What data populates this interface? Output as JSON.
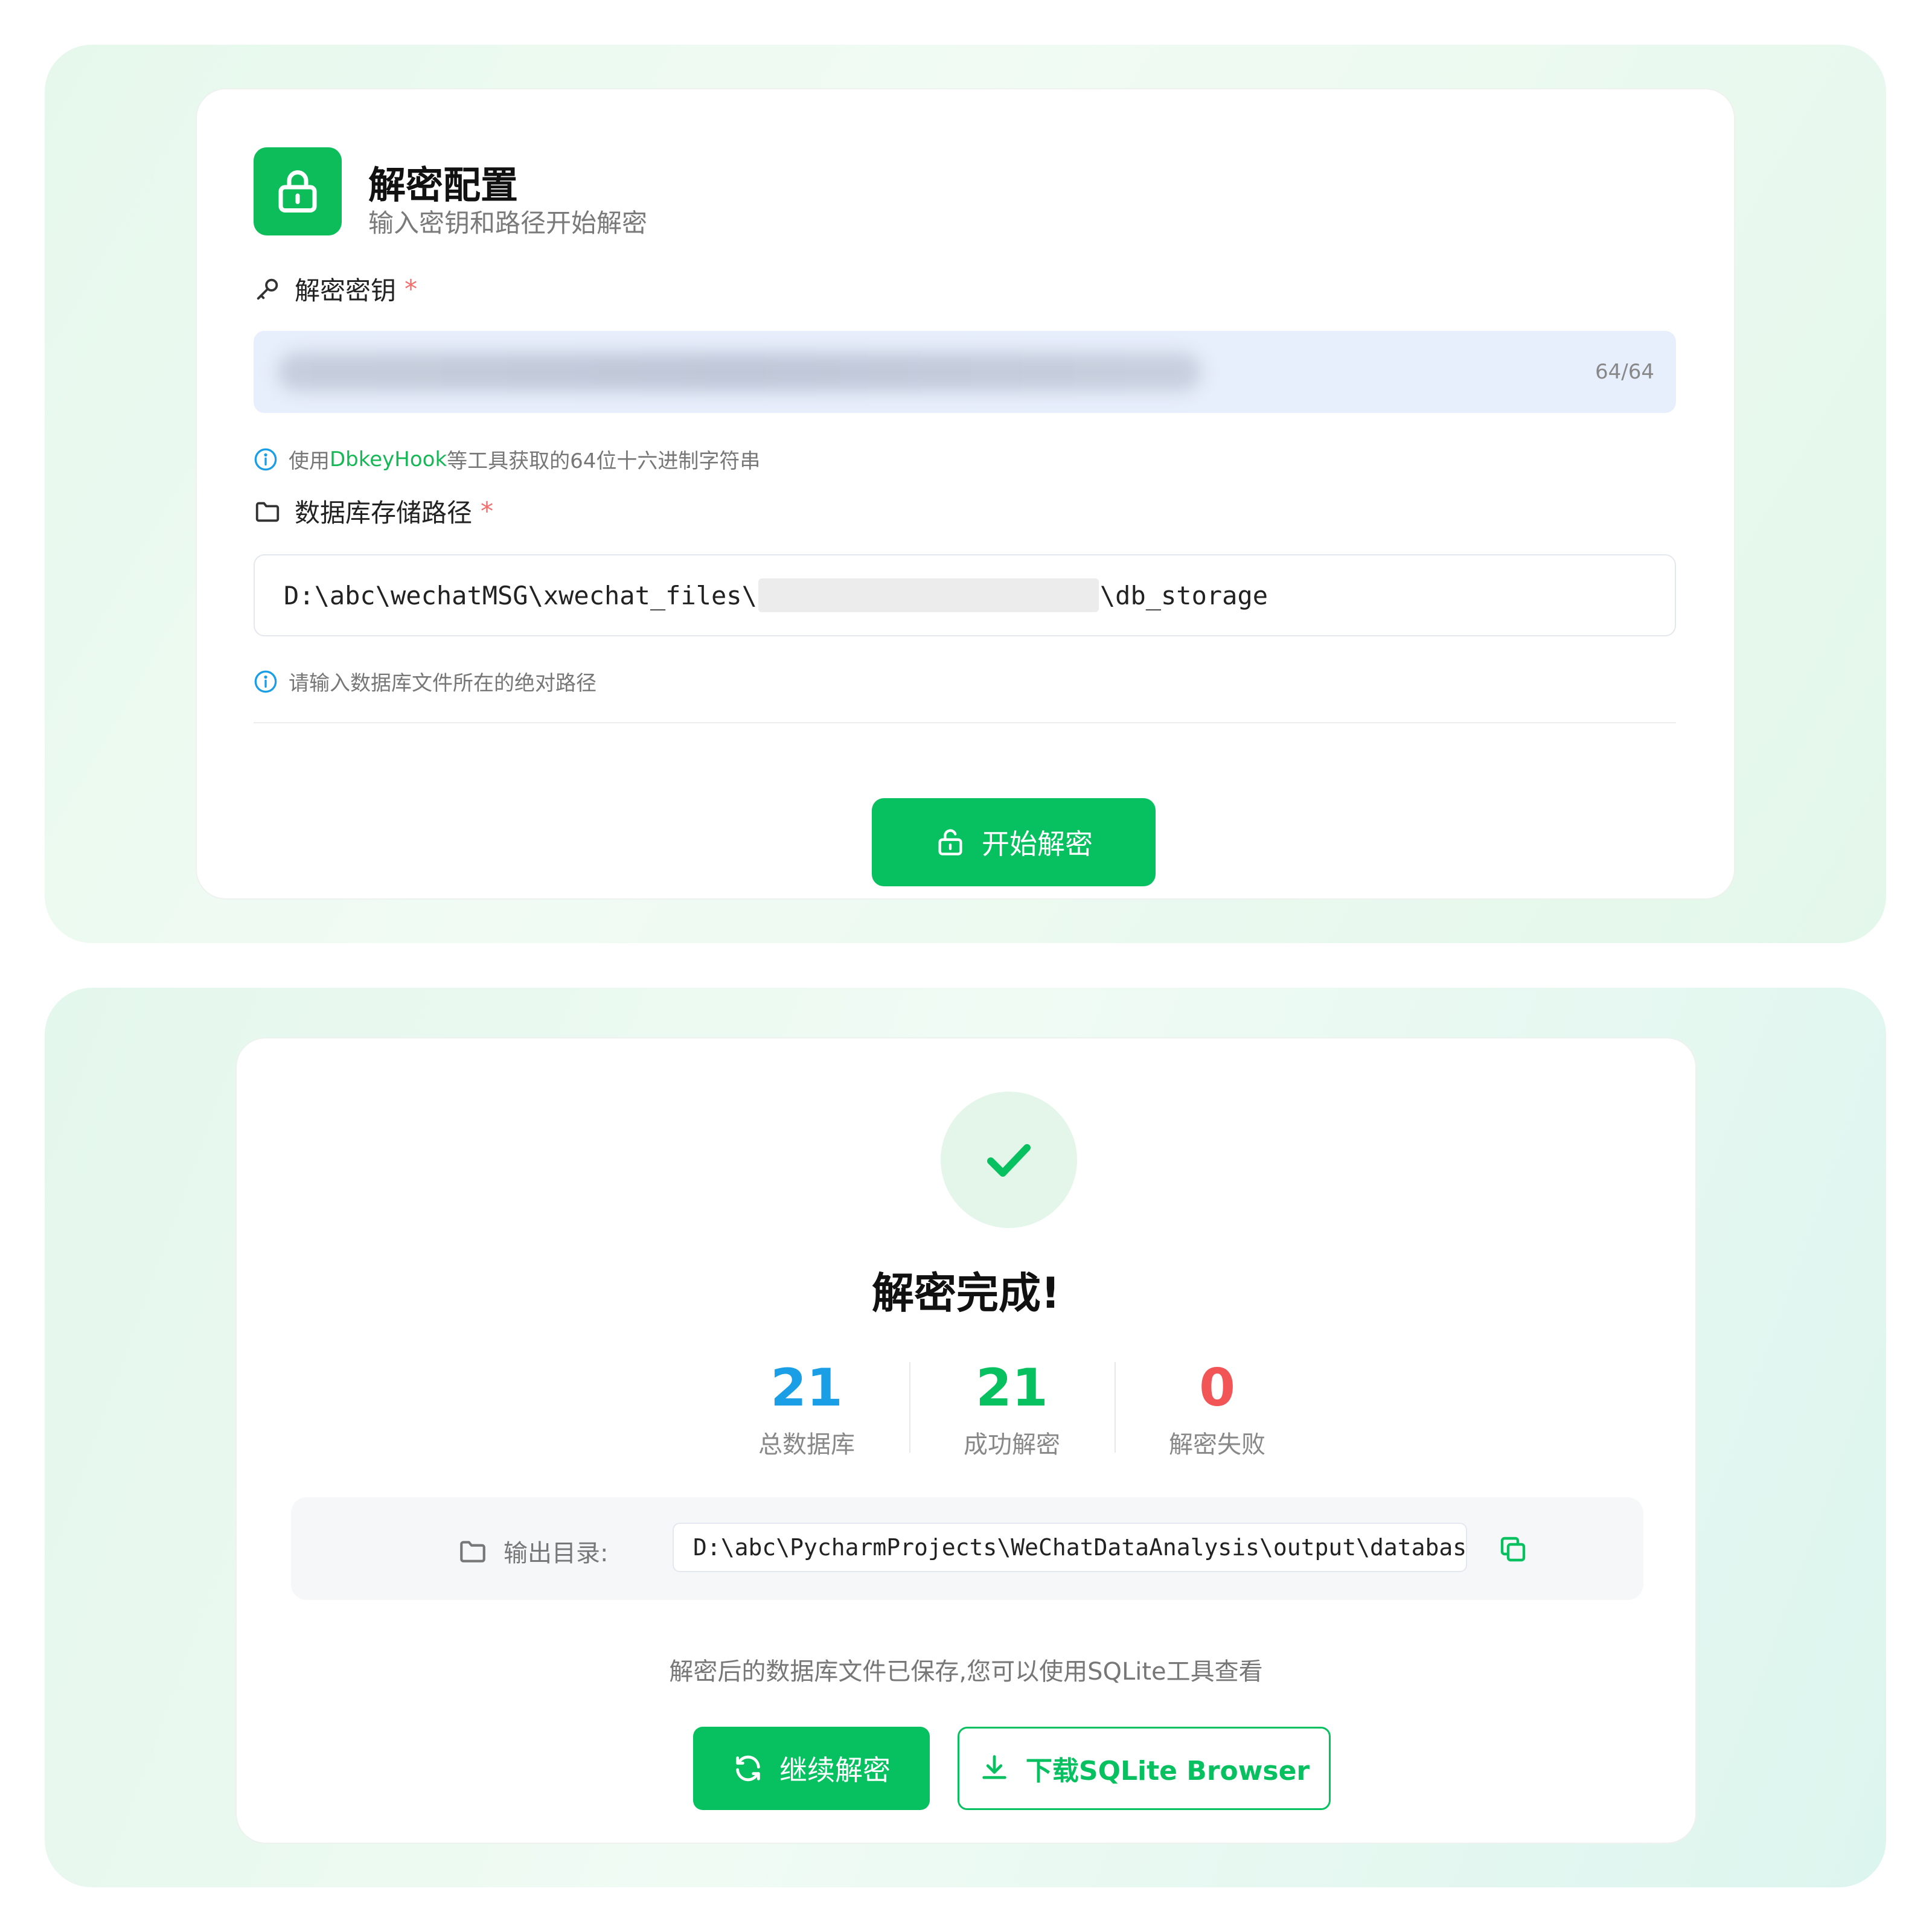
{
  "config": {
    "title": "解密配置",
    "subtitle": "输入密钥和路径开始解密",
    "key_field": {
      "label": "解密密钥",
      "required_mark": "*",
      "char_count": "64/64",
      "hint_prefix": "使用",
      "hint_link": "DbkeyHook",
      "hint_suffix": "等工具获取的64位十六进制字符串"
    },
    "path_field": {
      "label": "数据库存储路径",
      "required_mark": "*",
      "value_prefix": "D:\\abc\\wechatMSG\\xwechat_files\\",
      "value_suffix": "\\db_storage",
      "hint": "请输入数据库文件所在的绝对路径"
    },
    "start_button": "开始解密"
  },
  "result": {
    "title": "解密完成!",
    "stats": [
      {
        "value": "21",
        "label": "总数据库",
        "color": "#1a9ee6"
      },
      {
        "value": "21",
        "label": "成功解密",
        "color": "#07c160"
      },
      {
        "value": "0",
        "label": "解密失败",
        "color": "#f25555"
      }
    ],
    "output_label": "输出目录:",
    "output_path": "D:\\abc\\PycharmProjects\\WeChatDataAnalysis\\output\\databases",
    "note": "解密后的数据库文件已保存,您可以使用SQLite工具查看",
    "continue_button": "继续解密",
    "download_button": "下载SQLite Browser"
  },
  "colors": {
    "accent": "#07c160",
    "panel_bg": "#e6f8ec",
    "required": "#f56c6c"
  },
  "icons": [
    "lock-icon",
    "key-icon",
    "info-icon",
    "folder-icon",
    "unlock-icon",
    "check-icon",
    "copy-icon",
    "refresh-icon",
    "download-icon"
  ]
}
